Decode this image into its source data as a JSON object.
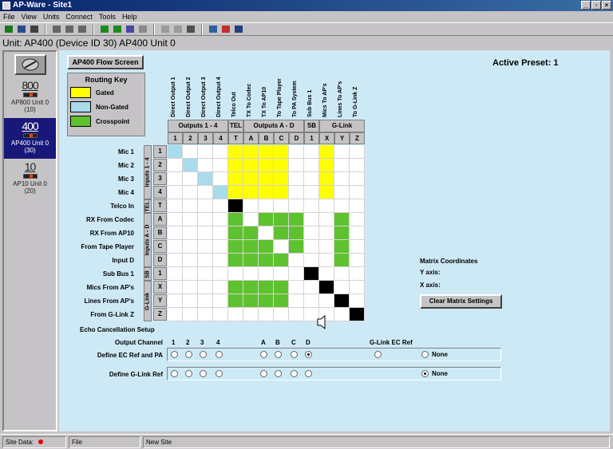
{
  "window": {
    "title": "AP-Ware - Site1",
    "min": "_",
    "restore": "▫",
    "close": "×"
  },
  "menu": [
    "File",
    "View",
    "Units",
    "Connect",
    "Tools",
    "Help"
  ],
  "unit_bar": "Unit: AP400 (Device ID 30) AP400 Unit 0",
  "sidebar": {
    "devices": [
      {
        "num": "800",
        "label": "AP800 Unit 0",
        "id": "(10)",
        "selected": false
      },
      {
        "num": "400",
        "label": "AP400 Unit 0",
        "id": "(30)",
        "selected": true
      },
      {
        "num": "10",
        "label": "AP10 Unit 0",
        "id": "(20)",
        "selected": false
      }
    ]
  },
  "main": {
    "flow_button": "AP400 Flow Screen",
    "active_preset": "Active Preset: 1",
    "routing_key": {
      "title": "Routing Key",
      "items": [
        {
          "label": "Gated",
          "color": "#ffff00"
        },
        {
          "label": "Non-Gated",
          "color": "#a8dcec"
        },
        {
          "label": "Crosspoint",
          "color": "#5ec22e"
        }
      ]
    },
    "columns": [
      {
        "name": "Direct Output 1",
        "num": "1"
      },
      {
        "name": "Direct Output 2",
        "num": "2"
      },
      {
        "name": "Direct Output 3",
        "num": "3"
      },
      {
        "name": "Direct Output 4",
        "num": "4"
      },
      {
        "name": "Telco Out",
        "num": "T"
      },
      {
        "name": "TX To Codec",
        "num": "A"
      },
      {
        "name": "TX To AP10",
        "num": "B"
      },
      {
        "name": "To Tape Player",
        "num": "C"
      },
      {
        "name": "To PA System",
        "num": "D"
      },
      {
        "name": "Sub Bus 1",
        "num": "1"
      },
      {
        "name": "Mics To AP's",
        "num": "X"
      },
      {
        "name": "Lines To AP's",
        "num": "Y"
      },
      {
        "name": "To G-Link Z",
        "num": "Z"
      }
    ],
    "column_groups": [
      {
        "label": "Outputs 1 - 4",
        "span": 4
      },
      {
        "label": "TEL",
        "span": 1
      },
      {
        "label": "Outputs A - D",
        "span": 4
      },
      {
        "label": "SB",
        "span": 1
      },
      {
        "label": "G-Link",
        "span": 3
      }
    ],
    "rows": [
      {
        "name": "Mic 1",
        "num": "1"
      },
      {
        "name": "Mic 2",
        "num": "2"
      },
      {
        "name": "Mic 3",
        "num": "3"
      },
      {
        "name": "Mic 4",
        "num": "4"
      },
      {
        "name": "Telco In",
        "num": "T"
      },
      {
        "name": "RX From Codec",
        "num": "A"
      },
      {
        "name": "RX From AP10",
        "num": "B"
      },
      {
        "name": "From Tape Player",
        "num": "C"
      },
      {
        "name": "Input D",
        "num": "D"
      },
      {
        "name": "Sub Bus 1",
        "num": "1"
      },
      {
        "name": "Mics From AP's",
        "num": "X"
      },
      {
        "name": "Lines From AP's",
        "num": "Y"
      },
      {
        "name": "From G-Link Z",
        "num": "Z"
      }
    ],
    "row_groups": [
      {
        "label": "Inputs 1 - 4",
        "span": 4
      },
      {
        "label": "TEL",
        "span": 1
      },
      {
        "label": "Inputs A - D",
        "span": 4
      },
      {
        "label": "SB",
        "span": 1
      },
      {
        "label": "G-Link",
        "span": 3
      }
    ],
    "matrix": [
      "c............",
      ".c...........",
      "..c..........",
      "...c.........",
      "....k........",
      "....g.ggg..g.",
      "....gg.gg..g.",
      "....ggg.g..g.",
      "....gggg...g.",
      ".........k...",
      "....gggg..k..",
      "....gggg...k.",
      "............k"
    ],
    "yellow_cols": [
      4,
      5,
      6,
      7,
      10
    ],
    "yellow_rows": [
      0,
      1,
      2,
      3
    ],
    "matrix_coordinates": {
      "title": "Matrix Coordinates",
      "y": "Y axis:",
      "x": "X axis:"
    },
    "clear_button": "Clear Matrix Settings",
    "echo": {
      "title": "Echo Cancellation Setup",
      "output_channel": "Output Channel",
      "channels": [
        "1",
        "2",
        "3",
        "4",
        "A",
        "B",
        "C",
        "D"
      ],
      "glink_ec_ref": "G-Link EC Ref",
      "define_ec": "Define EC Ref and PA",
      "define_glink": "Define G-Link Ref",
      "none": "None",
      "ec_selected": "D",
      "glink_selected": "None"
    }
  },
  "status": {
    "site_data": "Site Data:",
    "file": "File",
    "new_site": "New Site"
  }
}
